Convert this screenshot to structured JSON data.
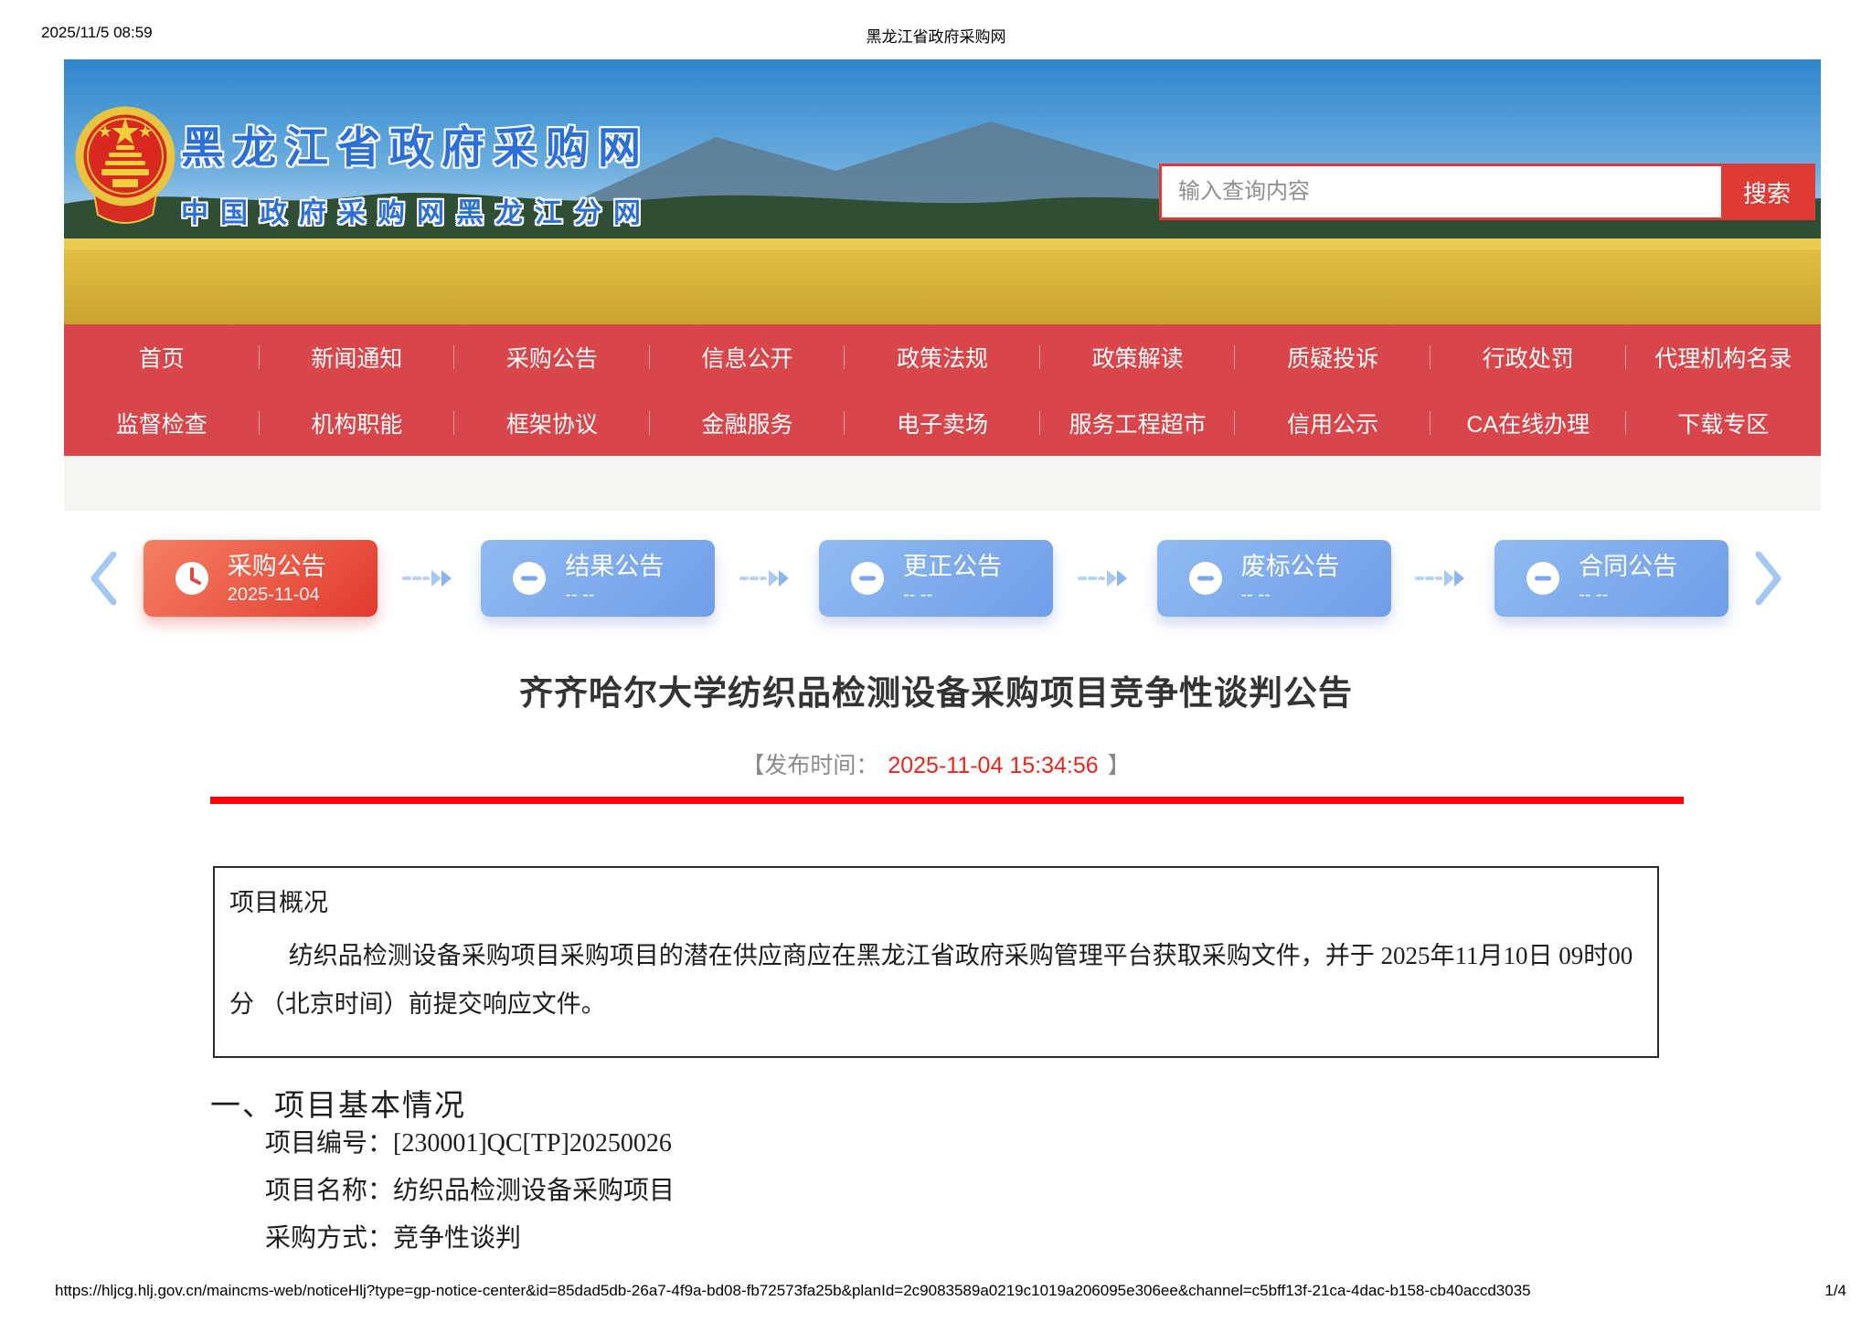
{
  "print_header": {
    "timestamp": "2025/11/5 08:59",
    "title": "黑龙江省政府采购网"
  },
  "banner": {
    "site_title": "黑龙江省政府采购网",
    "site_subtitle": "中国政府采购网黑龙江分网",
    "search": {
      "placeholder": "输入查询内容",
      "button_label": "搜索"
    }
  },
  "nav": {
    "row1": [
      "首页",
      "新闻通知",
      "采购公告",
      "信息公开",
      "政策法规",
      "政策解读",
      "质疑投诉",
      "行政处罚",
      "代理机构名录"
    ],
    "row2": [
      "监督检查",
      "机构职能",
      "框架协议",
      "金融服务",
      "电子卖场",
      "服务工程超市",
      "信用公示",
      "CA在线办理",
      "下载专区"
    ]
  },
  "steps": {
    "items": [
      {
        "label": "采购公告",
        "date": "2025-11-04",
        "active": true,
        "icon": "clock-icon"
      },
      {
        "label": "结果公告",
        "date": "-- --",
        "active": false,
        "icon": "minus-circle-icon"
      },
      {
        "label": "更正公告",
        "date": "-- --",
        "active": false,
        "icon": "minus-circle-icon"
      },
      {
        "label": "废标公告",
        "date": "-- --",
        "active": false,
        "icon": "minus-circle-icon"
      },
      {
        "label": "合同公告",
        "date": "-- --",
        "active": false,
        "icon": "minus-circle-icon"
      }
    ]
  },
  "article": {
    "title": "齐齐哈尔大学纺织品检测设备采购项目竞争性谈判公告",
    "publish_prefix": "【发布时间：",
    "publish_time": "2025-11-04 15:34:56",
    "publish_suffix": "】",
    "overview": {
      "heading": "项目概况",
      "body": "纺织品检测设备采购项目采购项目的潜在供应商应在黑龙江省政府采购管理平台获取采购文件，并于 2025年11月10日 09时00分 （北京时间）前提交响应文件。"
    },
    "section1": {
      "heading": "一、项目基本情况",
      "rows": [
        "项目编号：[230001]QC[TP]20250026",
        "项目名称：纺织品检测设备采购项目",
        "采购方式：竞争性谈判"
      ]
    }
  },
  "print_footer": {
    "url": "https://hljcg.hlj.gov.cn/maincms-web/noticeHlj?type=gp-notice-center&id=85dad5db-26a7-4f9a-bd08-fb72573fa25b&planId=2c9083589a0219c1019a206095e306ee&channel=c5bff13f-21ca-4dac-b158-cb40accd3035",
    "page": "1/4"
  },
  "colors": {
    "nav_red": "#d8454a",
    "accent_red": "#e03a35",
    "active_step_red": "#e13a2e",
    "step_blue": "#7ba6ea",
    "title_blue": "#2c6fd6",
    "publish_time_red": "#e8251c"
  }
}
